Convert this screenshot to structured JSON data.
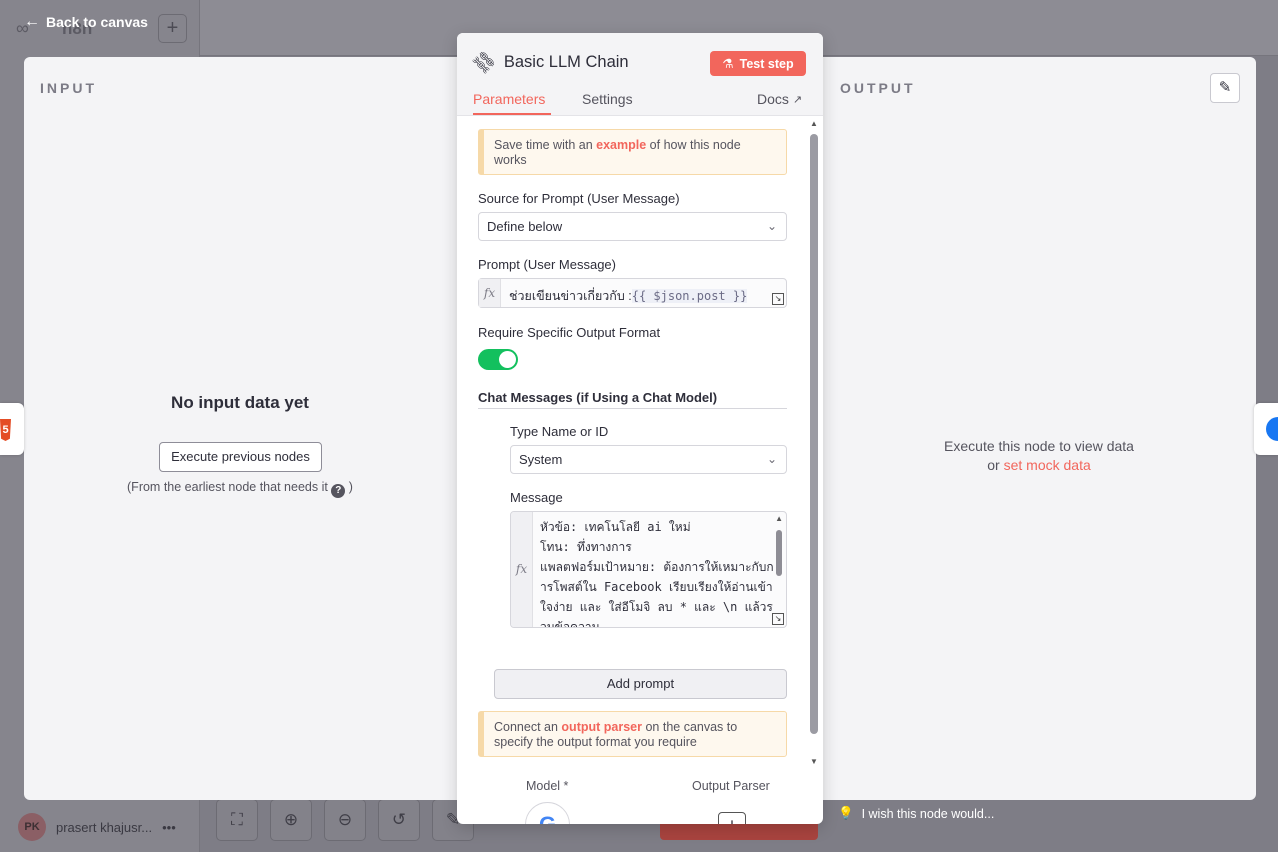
{
  "background": {
    "logo_text": "n8n",
    "back_label": "Back to canvas",
    "add_icon": "plus-icon",
    "user_initials": "PK",
    "user_name": "prasert khajusr...",
    "user_menu": "•••",
    "toolbar_icons": [
      "fit-view-icon",
      "zoom-in-icon",
      "zoom-out-icon",
      "undo-icon",
      "brush-icon"
    ]
  },
  "ndv": {
    "input_title": "INPUT",
    "output_title": "OUTPUT",
    "no_input_title": "No input data yet",
    "execute_previous_label": "Execute previous nodes",
    "earliest_hint": "(From the earliest node that needs it",
    "earliest_hint_end": ")",
    "output_hint_line1": "Execute this node to view data",
    "output_hint_or": "or",
    "output_hint_link": "set mock data",
    "wish_label": "I wish this node would..."
  },
  "dialog": {
    "node_title": "Basic LLM Chain",
    "test_step_label": "Test step",
    "tabs": {
      "parameters": "Parameters",
      "settings": "Settings",
      "docs": "Docs"
    },
    "notice_top": {
      "before": "Save time with an",
      "link": "example",
      "after": "of how this node works"
    },
    "source_label": "Source for Prompt (User Message)",
    "source_value": "Define below",
    "prompt_label": "Prompt (User Message)",
    "prompt_text": "ช่วยเขียนข่าวเกี่ยวกับ :",
    "prompt_expression": "{{ $json.post }}",
    "require_format_label": "Require Specific Output Format",
    "require_format_on": true,
    "chat_messages_label": "Chat Messages (if Using a Chat Model)",
    "type_label": "Type Name or ID",
    "type_value": "System",
    "message_label": "Message",
    "message_text": "หัวข้อ: เทคโนโลยี ai ใหม่\nโทน: ทึ่งทางการ\nแพลตฟอร์มเป้าหมาย: ต้องการให้เหมาะกับการโพสต์ใน Facebook เรียบเรียงให้อ่านเข้าใจง่าย และ ใส่อีโมจิ ลบ * และ \\n แล้วรวมข้อความ",
    "add_prompt_label": "Add prompt",
    "notice_bottom": {
      "before": "Connect an",
      "link": "output parser",
      "after": "on the canvas to specify the output format you require"
    },
    "model_label": "Model *",
    "output_parser_label": "Output Parser",
    "model_icon_letter": "G"
  },
  "colors": {
    "accent": "#f2665c",
    "toggle_on": "#13c05e",
    "notice_bg": "#fef8ee",
    "notice_border": "#f6d9a8"
  }
}
